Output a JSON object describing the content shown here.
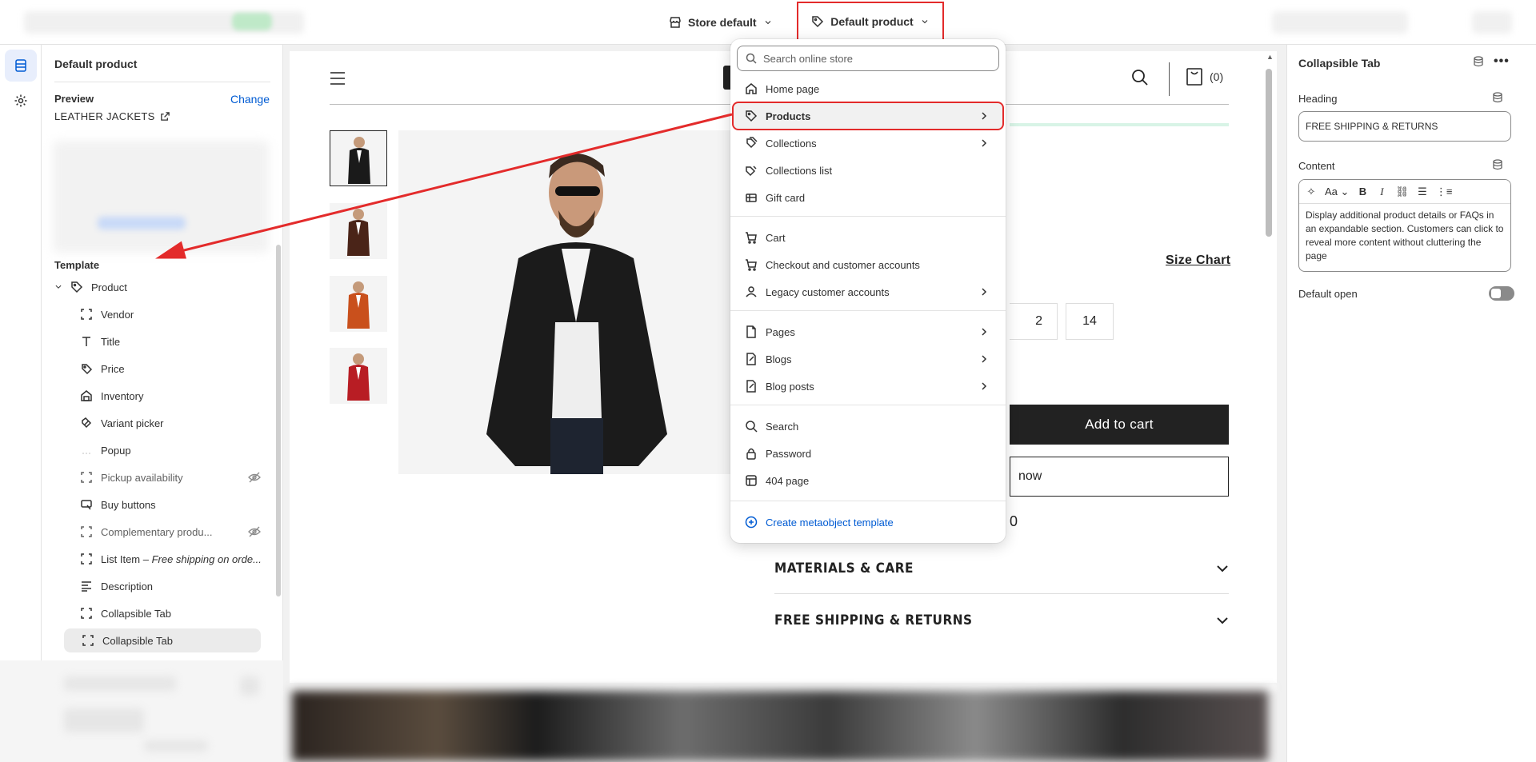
{
  "topbar": {
    "store_label": "Store default",
    "template_label": "Default product"
  },
  "left_panel": {
    "title": "Default product",
    "preview_label": "Preview",
    "change_label": "Change",
    "preview_product": "LEATHER JACKETS",
    "template_heading": "Template",
    "root": "Product",
    "items": [
      {
        "label": "Vendor",
        "icon": "dashed-square-icon"
      },
      {
        "label": "Title",
        "icon": "text-icon"
      },
      {
        "label": "Price",
        "icon": "price-tag-icon"
      },
      {
        "label": "Inventory",
        "icon": "inventory-icon"
      },
      {
        "label": "Variant picker",
        "icon": "variant-icon"
      },
      {
        "label": "Popup",
        "icon": "dots-icon"
      },
      {
        "label": "Pickup availability",
        "icon": "dashed-square-icon",
        "hidden": true
      },
      {
        "label": "Buy buttons",
        "icon": "buy-icon"
      },
      {
        "label": "Complementary produ...",
        "icon": "dashed-square-icon",
        "hidden": true
      },
      {
        "label": "List Item",
        "italic": "– Free shipping on orde...",
        "icon": "dashed-square-icon"
      },
      {
        "label": "Description",
        "icon": "align-left-icon"
      },
      {
        "label": "Collapsible Tab",
        "icon": "dashed-square-icon"
      },
      {
        "label": "Collapsible Tab",
        "icon": "dashed-square-icon",
        "selected": true
      }
    ]
  },
  "dropdown": {
    "search_placeholder": "Search online store",
    "groups": [
      [
        {
          "label": "Home page",
          "icon": "home-icon"
        },
        {
          "label": "Products",
          "icon": "tag-icon",
          "chevron": true,
          "highlighted": true
        },
        {
          "label": "Collections",
          "icon": "collection-icon",
          "chevron": true
        },
        {
          "label": "Collections list",
          "icon": "collections-list-icon"
        },
        {
          "label": "Gift card",
          "icon": "gift-card-icon"
        }
      ],
      [
        {
          "label": "Cart",
          "icon": "cart-icon"
        },
        {
          "label": "Checkout and customer accounts",
          "icon": "checkout-icon"
        },
        {
          "label": "Legacy customer accounts",
          "icon": "person-icon",
          "chevron": true
        }
      ],
      [
        {
          "label": "Pages",
          "icon": "page-icon",
          "chevron": true
        },
        {
          "label": "Blogs",
          "icon": "blog-icon",
          "chevron": true
        },
        {
          "label": "Blog posts",
          "icon": "blog-post-icon",
          "chevron": true
        }
      ],
      [
        {
          "label": "Search",
          "icon": "search-icon"
        },
        {
          "label": "Password",
          "icon": "lock-icon"
        },
        {
          "label": "404 page",
          "icon": "error-page-icon"
        }
      ]
    ],
    "create_label": "Create metaobject template"
  },
  "storefront": {
    "cart_count": "(0)",
    "size_chart": "Size Chart",
    "sizes": [
      "2",
      "14"
    ],
    "add_to_cart": "Add to cart",
    "buy_now": "now",
    "partial_price": "0",
    "accordions": [
      "MATERIALS & CARE",
      "FREE SHIPPING & RETURNS"
    ],
    "thumbnail_colors": [
      "#1a1a1a",
      "#4a2418",
      "#c9501c",
      "#b81d24"
    ]
  },
  "right_panel": {
    "title": "Collapsible Tab",
    "more": "•••",
    "heading_label": "Heading",
    "heading_value": "FREE SHIPPING & RETURNS",
    "content_label": "Content",
    "content_text": "Display additional product details or FAQs in an expandable section. Customers can click to reveal more content without cluttering the page",
    "default_open_label": "Default open",
    "default_open": false
  },
  "colors": {
    "accent_blue": "#005bd3",
    "annotation_red": "#e32b2b"
  }
}
